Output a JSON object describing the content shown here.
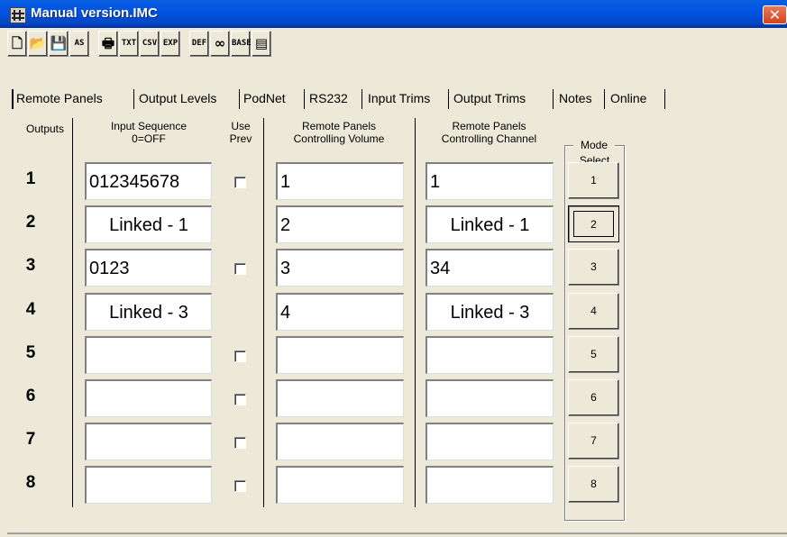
{
  "window": {
    "title": "Manual version.IMC",
    "close_glyph": "✕"
  },
  "toolbar": [
    {
      "name": "new-file-icon",
      "label": "🗋"
    },
    {
      "name": "open-folder-icon",
      "label": "📂"
    },
    {
      "name": "save-icon",
      "label": "💾"
    },
    {
      "name": "save-as-icon",
      "label": "AS"
    },
    {
      "name": "print-icon",
      "label": "🖶"
    },
    {
      "name": "export-txt-button",
      "label": "TXT"
    },
    {
      "name": "export-csv-button",
      "label": "CSV"
    },
    {
      "name": "export-exp-button",
      "label": "EXP"
    },
    {
      "name": "def-button",
      "label": "DEF"
    },
    {
      "name": "link-icon",
      "label": "∞"
    },
    {
      "name": "base-button",
      "label": "BASE"
    },
    {
      "name": "panel-icon",
      "label": "▤"
    }
  ],
  "tabs": [
    "Remote Panels",
    "Output Levels",
    "PodNet",
    "RS232",
    "Input Trims",
    "Output Trims",
    "Notes",
    "Online"
  ],
  "headers": {
    "outputs": "Outputs",
    "input_sequence": [
      "Input Sequence",
      "0=OFF"
    ],
    "use_prev": [
      "Use",
      "Prev"
    ],
    "remote_volume": [
      "Remote Panels",
      "Controlling Volume"
    ],
    "remote_channel": [
      "Remote Panels",
      "Controlling Channel"
    ],
    "mode": "Mode",
    "select": "Select"
  },
  "rows": [
    {
      "num": "1",
      "input_sequence": "012345678",
      "use_prev": "unchecked",
      "volume": "1",
      "channel": "1"
    },
    {
      "num": "2",
      "input_sequence": "Linked - 1",
      "use_prev": "none",
      "volume": "2",
      "channel": "Linked - 1"
    },
    {
      "num": "3",
      "input_sequence": "0123",
      "use_prev": "unchecked",
      "volume": "3",
      "channel": "34"
    },
    {
      "num": "4",
      "input_sequence": "Linked - 3",
      "use_prev": "none",
      "volume": "4",
      "channel": "Linked - 3"
    },
    {
      "num": "5",
      "input_sequence": "",
      "use_prev": "unchecked",
      "volume": "",
      "channel": ""
    },
    {
      "num": "6",
      "input_sequence": "",
      "use_prev": "unchecked",
      "volume": "",
      "channel": ""
    },
    {
      "num": "7",
      "input_sequence": "",
      "use_prev": "unchecked",
      "volume": "",
      "channel": ""
    },
    {
      "num": "8",
      "input_sequence": "",
      "use_prev": "unchecked",
      "volume": "",
      "channel": ""
    }
  ],
  "mode_buttons": [
    "1",
    "2",
    "3",
    "4",
    "5",
    "6",
    "7",
    "8"
  ],
  "mode_selected": "2",
  "colors": {
    "titlebar": "#0054e3",
    "face": "#ece9d8",
    "field": "#ffffff"
  }
}
